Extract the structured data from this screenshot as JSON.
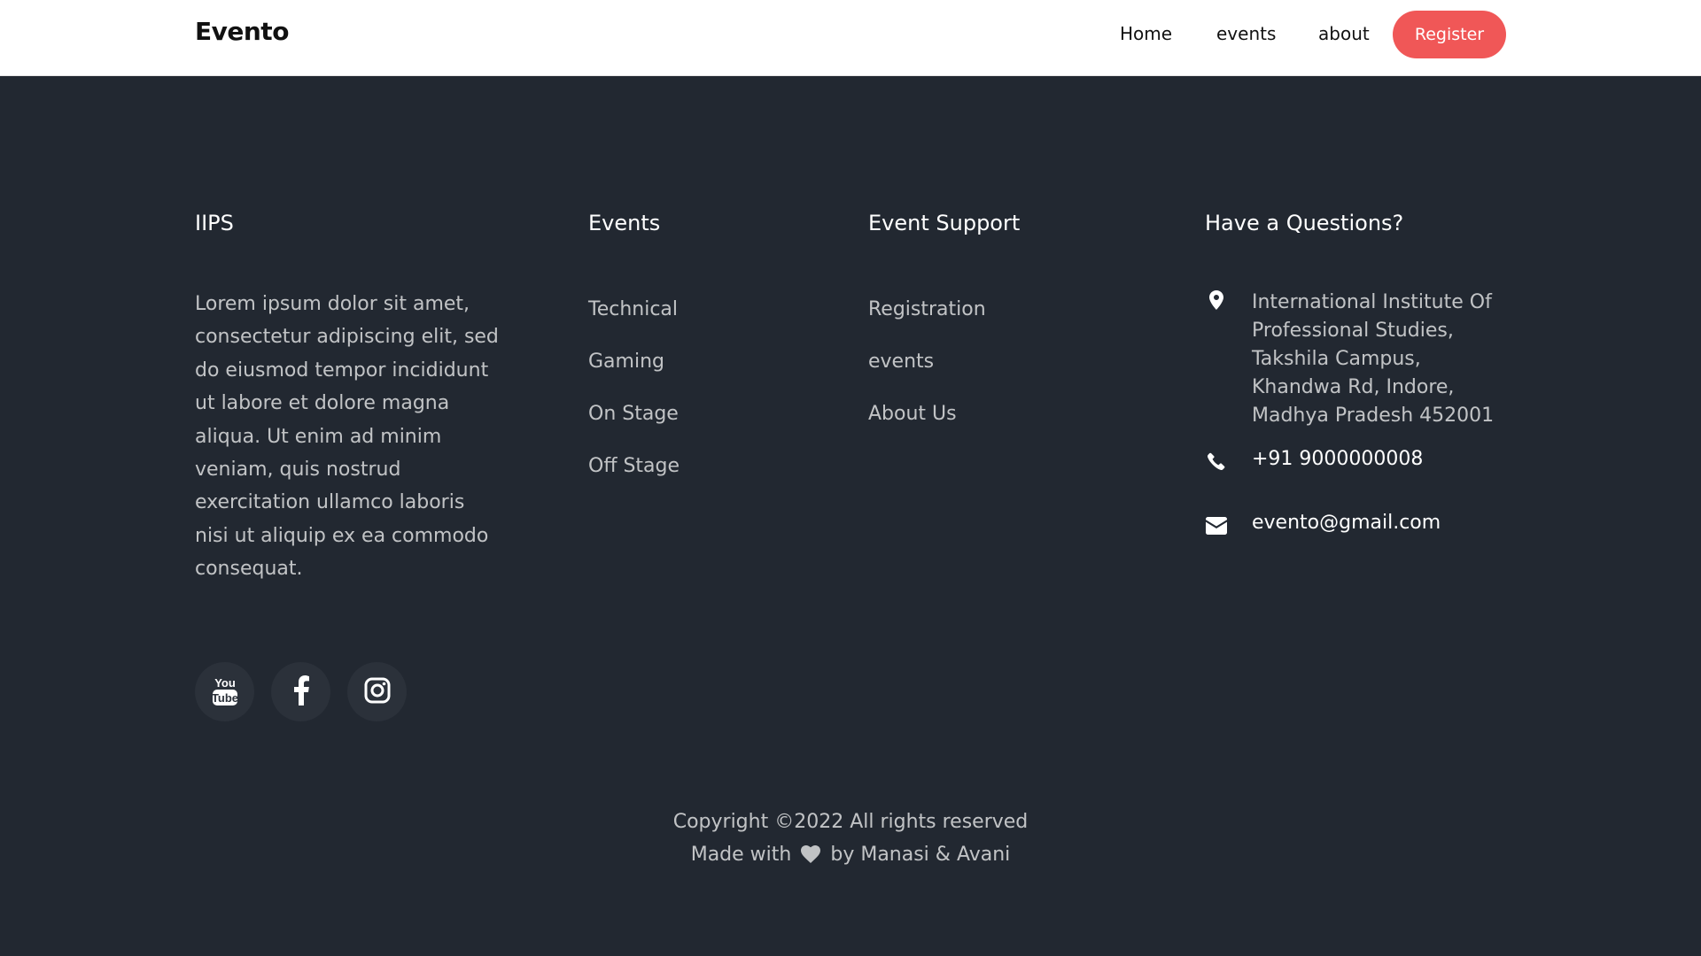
{
  "nav": {
    "brand": "Evento",
    "links": [
      "Home",
      "events",
      "about"
    ],
    "register_label": "Register"
  },
  "footer": {
    "col1": {
      "title": "IIPS",
      "text": "Lorem ipsum dolor sit amet, consectetur adipiscing elit, sed do eiusmod tempor incididunt ut labore et dolore magna aliqua. Ut enim ad minim veniam, quis nostrud exercitation ullamco laboris nisi ut aliquip ex ea commodo consequat."
    },
    "col2": {
      "title": "Events",
      "links": [
        "Technical",
        "Gaming",
        "On Stage",
        "Off Stage"
      ]
    },
    "col3": {
      "title": "Event Support",
      "links": [
        "Registration",
        "events",
        "About Us"
      ]
    },
    "col4": {
      "title": "Have a Questions?",
      "address": "International Institute Of Professional Studies, Takshila Campus, Khandwa Rd, Indore, Madhya Pradesh 452001",
      "phone": "+91 9000000008",
      "email": "evento@gmail.com"
    },
    "social": [
      "youtube-icon",
      "facebook-icon",
      "instagram-icon"
    ],
    "copyright_line1": "Copyright ©2022 All rights reserved",
    "made_with_prefix": "Made with",
    "made_with_suffix": "by Manasi & Avani"
  },
  "colors": {
    "background": "#222831",
    "accent": "#f05757",
    "social_bg": "#2b313a"
  }
}
